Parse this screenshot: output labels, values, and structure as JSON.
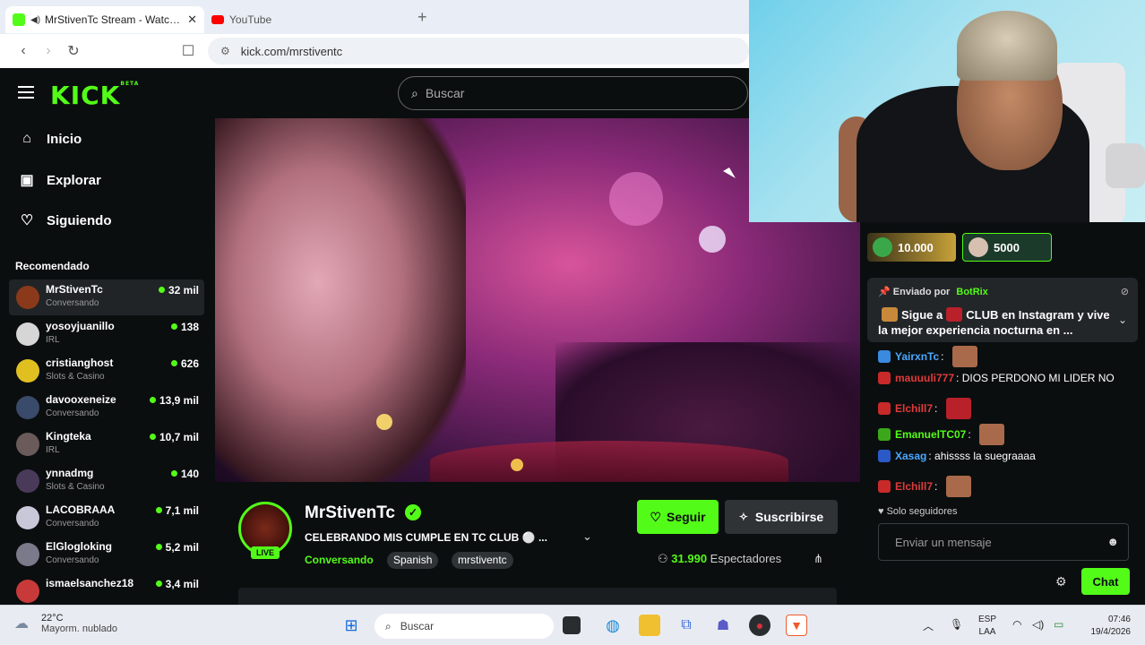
{
  "browser": {
    "tabs": [
      {
        "title": "MrStivenTc Stream - Watch Live",
        "favicon_color": "#53fc18",
        "active": true
      },
      {
        "title": "YouTube",
        "favicon_color": "#ff0000",
        "active": false
      }
    ],
    "new_tab": "+",
    "url": "kick.com/mrstiventc"
  },
  "kick": {
    "logo": "KICK",
    "logo_sup": "BETA",
    "search_placeholder": "Buscar",
    "accent": "#53fc18"
  },
  "sidebar": {
    "nav": [
      {
        "label": "Inicio",
        "icon": "home-icon"
      },
      {
        "label": "Explorar",
        "icon": "compass-icon"
      },
      {
        "label": "Siguiendo",
        "icon": "heart-icon"
      }
    ],
    "recommended_title": "Recomendado",
    "channels": [
      {
        "name": "MrStivenTc",
        "category": "Conversando",
        "viewers": "32 mil",
        "avatar_color": "#8a3a1a"
      },
      {
        "name": "yosoyjuanillo",
        "category": "IRL",
        "viewers": "138",
        "avatar_color": "#d6d6d6"
      },
      {
        "name": "cristianghost",
        "category": "Slots & Casino",
        "viewers": "626",
        "avatar_color": "#e0c020"
      },
      {
        "name": "davooxeneize",
        "category": "Conversando",
        "viewers": "13,9 mil",
        "avatar_color": "#3a4a6a"
      },
      {
        "name": "Kingteka",
        "category": "IRL",
        "viewers": "10,7 mil",
        "avatar_color": "#6a5a5a"
      },
      {
        "name": "ynnadmg",
        "category": "Slots & Casino",
        "viewers": "140",
        "avatar_color": "#4a3a5a"
      },
      {
        "name": "LACOBRAAA",
        "category": "Conversando",
        "viewers": "7,1 mil",
        "avatar_color": "#c8c8d8"
      },
      {
        "name": "ElGlogloking",
        "category": "Conversando",
        "viewers": "5,2 mil",
        "avatar_color": "#7a7a8a"
      },
      {
        "name": "ismaelsanchez18",
        "category": "",
        "viewers": "3,4 mil",
        "avatar_color": "#c83a3a"
      }
    ]
  },
  "chat": {
    "gifts": [
      {
        "amount": "10.000",
        "color": "#c8a23a"
      },
      {
        "amount": "5000",
        "color": "#1a8a5a"
      }
    ],
    "pinned": {
      "sent_by_label": "Enviado por",
      "bot_name": "BotRix",
      "message_part1": "Sigue a",
      "message_part2": "CLUB en Instagram y vive la mejor experiencia nocturna en ..."
    },
    "messages": [
      {
        "user": "YairxnTc",
        "text": "",
        "user_color": "#4aa8ff",
        "badge_color": "#3a8adf",
        "emote": true
      },
      {
        "user": "mauuuli777",
        "text": "DIOS PERDONO MI LIDER NO",
        "user_color": "#e03a3a",
        "badge_color": "#c82a2a",
        "emote": false
      },
      {
        "user": "Elchill7",
        "text": "",
        "user_color": "#e03a3a",
        "badge_color": "#c82a2a",
        "emote": true
      },
      {
        "user": "EmanuelTC07",
        "text": "",
        "user_color": "#53fc18",
        "badge_color": "#3aa81a",
        "emote": true
      },
      {
        "user": "Xasag",
        "text": "ahissss la suegraaaa",
        "user_color": "#4aa8ff",
        "badge_color": "#2a5ac8",
        "emote": false
      },
      {
        "user": "Elchill7",
        "text": "",
        "user_color": "#e03a3a",
        "badge_color": "#c82a2a",
        "emote": true
      }
    ],
    "followers_only": "Solo seguidores",
    "input_placeholder": "Enviar un mensaje",
    "send_button": "Chat"
  },
  "stream": {
    "channel_name": "MrStivenTc",
    "live_label": "LIVE",
    "title": "CELEBRANDO MIS CUMPLE EN TC CLUB ⚪ ...",
    "category": "Conversando",
    "tags": [
      "Spanish",
      "mrstiventc"
    ],
    "follow_button": "Seguir",
    "subscribe_button": "Suscribirse",
    "viewers": "31.990",
    "viewers_label": "Espectadores"
  },
  "taskbar": {
    "weather_temp": "22°C",
    "weather_desc": "Mayorm. nublado",
    "search_placeholder": "Buscar",
    "lang_line1": "ESP",
    "lang_line2": "LAA",
    "time": "07:46",
    "date": "19/4/2026"
  }
}
